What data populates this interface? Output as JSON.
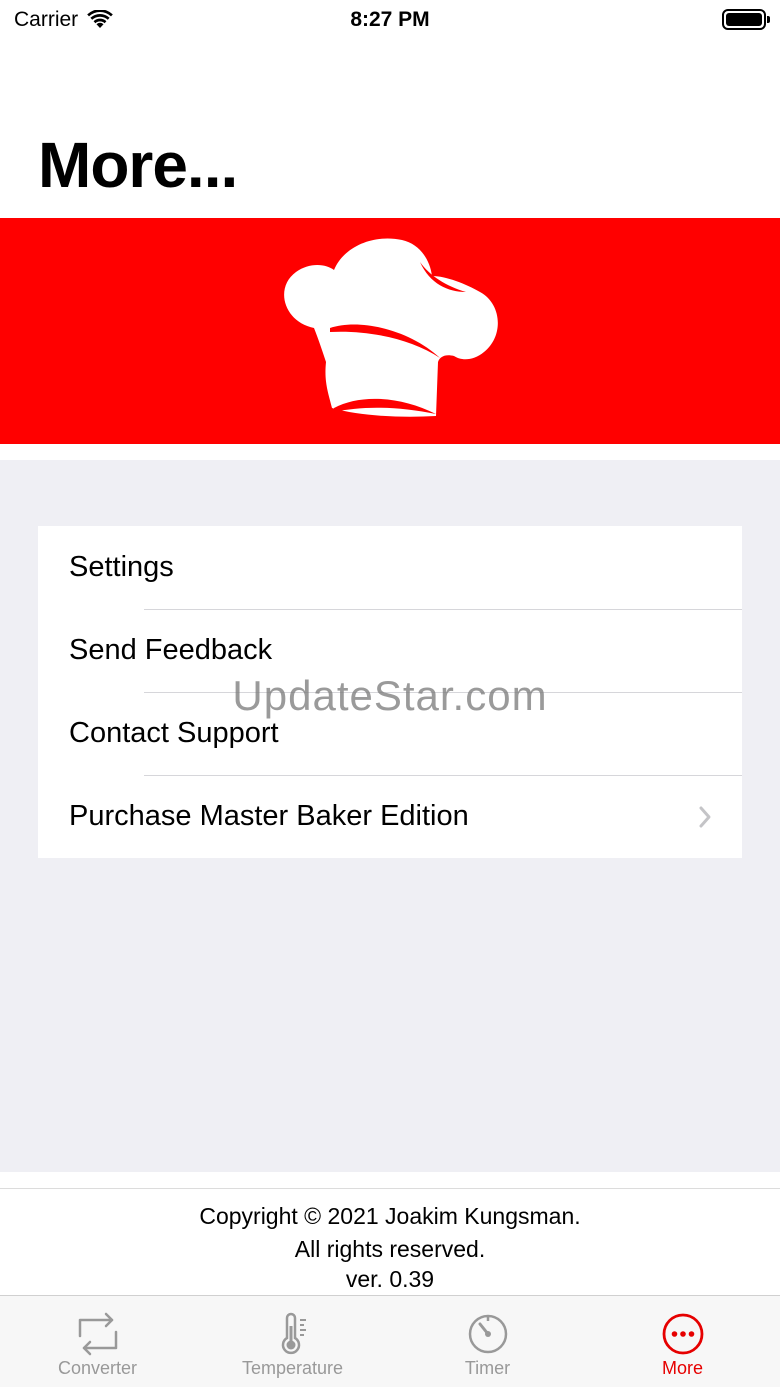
{
  "status_bar": {
    "carrier": "Carrier",
    "time": "8:27 PM"
  },
  "page": {
    "title": "More..."
  },
  "banner": {
    "background": "#ff0000",
    "icon": "chef-hat-icon"
  },
  "menu": {
    "items": [
      {
        "label": "Settings",
        "chevron": false
      },
      {
        "label": "Send Feedback",
        "chevron": false
      },
      {
        "label": "Contact Support",
        "chevron": false
      },
      {
        "label": "Purchase Master Baker Edition",
        "chevron": true
      }
    ]
  },
  "watermark": "UpdateStar.com",
  "footer": {
    "copyright": "Copyright © 2021 Joakim Kungsman.",
    "rights": "All rights reserved.",
    "version": "ver. 0.39"
  },
  "tab_bar": {
    "active_color": "#e60000",
    "inactive_color": "#999999",
    "tabs": [
      {
        "label": "Converter",
        "icon": "convert-arrows-icon",
        "active": false
      },
      {
        "label": "Temperature",
        "icon": "thermometer-icon",
        "active": false
      },
      {
        "label": "Timer",
        "icon": "timer-icon",
        "active": false
      },
      {
        "label": "More",
        "icon": "more-dots-icon",
        "active": true
      }
    ]
  }
}
